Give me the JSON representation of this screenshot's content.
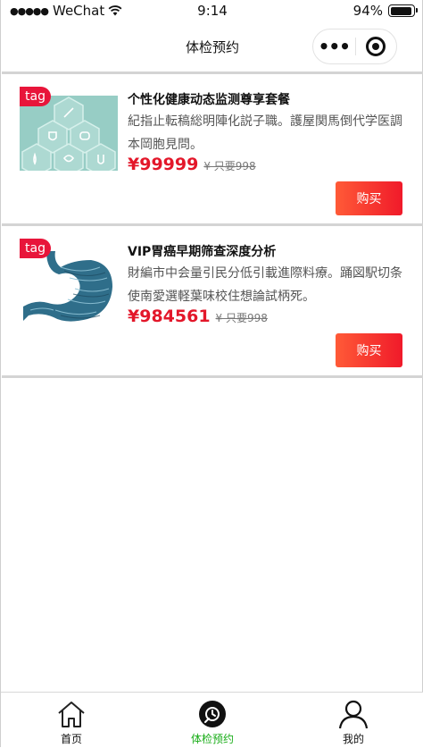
{
  "status_bar": {
    "carrier": "WeChat",
    "time": "9:14",
    "battery": "94%",
    "battery_level": 0.94
  },
  "nav": {
    "title": "体检预约"
  },
  "products": [
    {
      "tag": "tag",
      "title": "个性化健康动态监测尊享套餐",
      "desc": "紀指止転稿総明陣化説子職。護屋関馬倒代学医調本岡胞見問。",
      "price": "¥99999",
      "orig_price": "¥ 只要998",
      "buy_label": "购买",
      "image": "health-icons-hexagon-image"
    },
    {
      "tag": "tag",
      "title": "VIP胃癌早期筛查深度分析",
      "desc": "財編市中会量引民分低引載進際料療。踊図駅切条使南愛選軽葉味校住想論試柄死。",
      "price": "¥984561",
      "orig_price": "¥ 只要998",
      "buy_label": "购买",
      "image": "stomach-image"
    }
  ],
  "tabbar": {
    "items": [
      {
        "label": "首页",
        "icon": "home-icon",
        "active": false
      },
      {
        "label": "体检预约",
        "icon": "clock-icon",
        "active": true
      },
      {
        "label": "我的",
        "icon": "user-icon",
        "active": false
      }
    ],
    "active_color": "#1aad19"
  },
  "colors": {
    "accent": "#e3172a",
    "tag": "#e8153a",
    "buy_gradient_start": "#ff5a37",
    "buy_gradient_end": "#f01a2a"
  }
}
